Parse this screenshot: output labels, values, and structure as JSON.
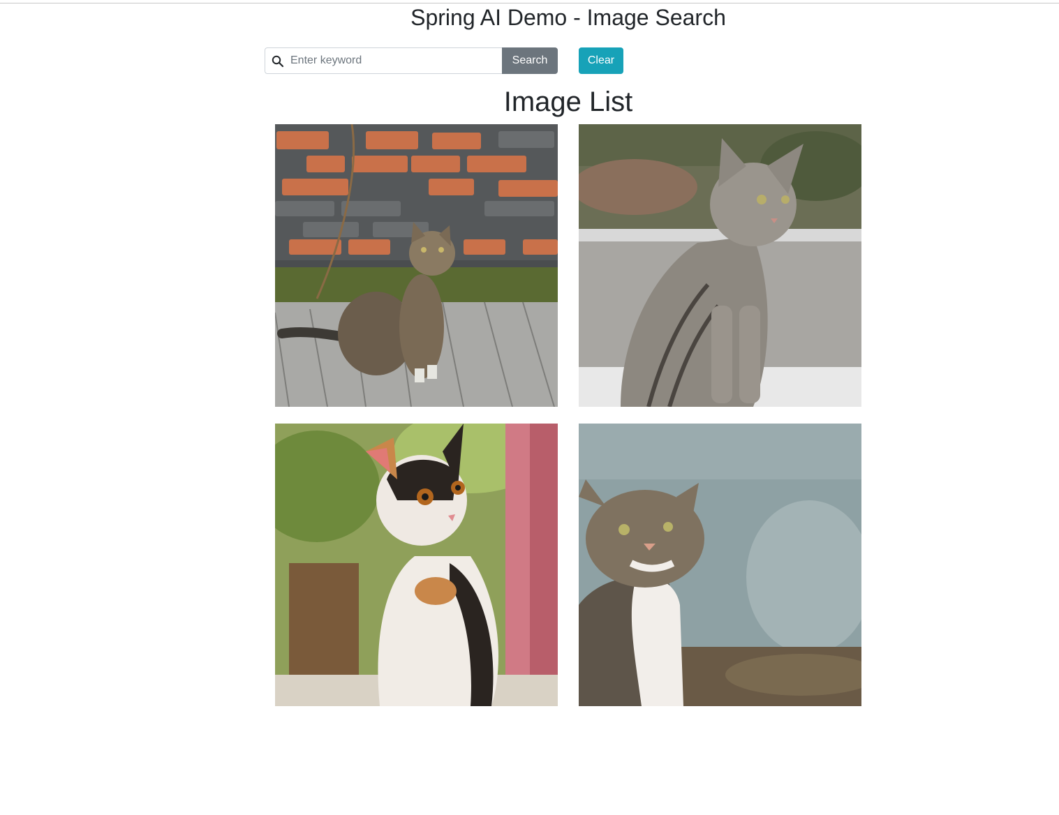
{
  "header": {
    "title": "Spring AI Demo - Image Search"
  },
  "search": {
    "placeholder": "Enter keyword",
    "value": "",
    "icon": "search-icon",
    "search_label": "Search",
    "clear_label": "Clear"
  },
  "results": {
    "heading": "Image List",
    "images": [
      {
        "alt": "tabby cat sitting on wooden deck by brick wall"
      },
      {
        "alt": "gray striped tabby cat sitting on concrete ledge"
      },
      {
        "alt": "calico cat sitting near pink post"
      },
      {
        "alt": "tabby and white cat in front of blue-gray wall"
      }
    ]
  },
  "colors": {
    "search_button": "#6c757d",
    "clear_button": "#17a2b8",
    "text": "#212529"
  }
}
